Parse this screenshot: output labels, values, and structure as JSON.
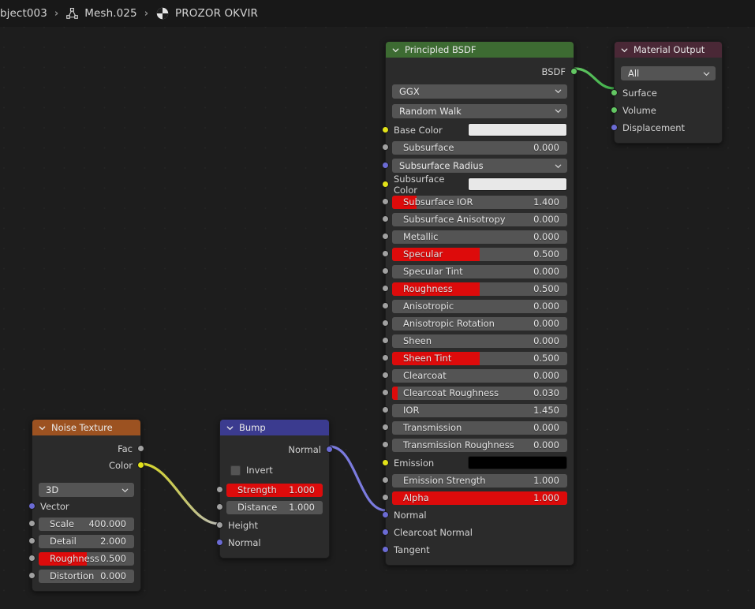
{
  "breadcrumb": {
    "object": "bject003",
    "mesh": "Mesh.025",
    "material": "PROZOR OKVIR",
    "separator": "›",
    "mesh_icon": "mesh-data-icon",
    "material_icon": "material-sphere-icon"
  },
  "colors": {
    "background": "#1d1d1d",
    "node_body": "#2b2b2b",
    "header_bsdf": "#3d6b32",
    "header_output": "#4a2836",
    "header_noise": "#9c5221",
    "header_bump": "#3b3b8f",
    "slider_track": "#545454",
    "slider_fill": "#dd0b0b",
    "socket_shader": "#63c763",
    "socket_color": "#e2e219",
    "socket_vector": "#6b6bd4",
    "socket_value": "#a1a1a1",
    "link_shader": "#4caf50",
    "link_color": "#d8d823",
    "link_vector": "#7b7bdd",
    "link_value": "#b0b0b0"
  },
  "nodes": {
    "principled_bsdf": {
      "title": "Principled BSDF",
      "outputs": [
        {
          "name": "BSDF",
          "socket": "shader"
        }
      ],
      "dropdowns": [
        {
          "name": "distribution",
          "value": "GGX"
        },
        {
          "name": "subsurface-method",
          "value": "Random Walk"
        }
      ],
      "color_inputs": [
        {
          "label": "Base Color",
          "color": "#e8e8e8",
          "socket": "color"
        },
        {
          "label": "Subsurface Color",
          "color": "#e8e8e8",
          "socket": "color"
        },
        {
          "label": "Emission",
          "color": "#000000",
          "socket": "color"
        }
      ],
      "subsurface_radius": {
        "label": "Subsurface Radius",
        "socket": "vector"
      },
      "values": [
        {
          "label": "Subsurface",
          "value": "0.000",
          "fill": 0
        },
        {
          "label": "Subsurface IOR",
          "value": "1.400",
          "fill": 14
        },
        {
          "label": "Subsurface Anisotropy",
          "value": "0.000",
          "fill": 0
        },
        {
          "label": "Metallic",
          "value": "0.000",
          "fill": 0
        },
        {
          "label": "Specular",
          "value": "0.500",
          "fill": 50
        },
        {
          "label": "Specular Tint",
          "value": "0.000",
          "fill": 0
        },
        {
          "label": "Roughness",
          "value": "0.500",
          "fill": 50
        },
        {
          "label": "Anisotropic",
          "value": "0.000",
          "fill": 0
        },
        {
          "label": "Anisotropic Rotation",
          "value": "0.000",
          "fill": 0
        },
        {
          "label": "Sheen",
          "value": "0.000",
          "fill": 0
        },
        {
          "label": "Sheen Tint",
          "value": "0.500",
          "fill": 50
        },
        {
          "label": "Clearcoat",
          "value": "0.000",
          "fill": 0
        },
        {
          "label": "Clearcoat Roughness",
          "value": "0.030",
          "fill": 3
        },
        {
          "label": "IOR",
          "value": "1.450",
          "fill": 0
        },
        {
          "label": "Transmission",
          "value": "0.000",
          "fill": 0
        },
        {
          "label": "Transmission Roughness",
          "value": "0.000",
          "fill": 0
        },
        {
          "label": "Emission Strength",
          "value": "1.000",
          "fill": 0
        },
        {
          "label": "Alpha",
          "value": "1.000",
          "fill": 100
        }
      ],
      "vector_inputs": [
        {
          "label": "Normal",
          "socket": "vector"
        },
        {
          "label": "Clearcoat Normal",
          "socket": "vector"
        },
        {
          "label": "Tangent",
          "socket": "vector"
        }
      ]
    },
    "material_output": {
      "title": "Material Output",
      "target": "All",
      "inputs": [
        {
          "label": "Surface",
          "socket": "shader"
        },
        {
          "label": "Volume",
          "socket": "shader"
        },
        {
          "label": "Displacement",
          "socket": "vector"
        }
      ]
    },
    "noise_texture": {
      "title": "Noise Texture",
      "outputs": [
        {
          "label": "Fac",
          "socket": "value"
        },
        {
          "label": "Color",
          "socket": "color"
        }
      ],
      "dimensions": "3D",
      "vector_input": {
        "label": "Vector",
        "socket": "vector"
      },
      "values": [
        {
          "label": "Scale",
          "value": "400.000",
          "fill": 0
        },
        {
          "label": "Detail",
          "value": "2.000",
          "fill": 0
        },
        {
          "label": "Roughness",
          "value": "0.500",
          "fill": 50
        },
        {
          "label": "Distortion",
          "value": "0.000",
          "fill": 0
        }
      ]
    },
    "bump": {
      "title": "Bump",
      "outputs": [
        {
          "label": "Normal",
          "socket": "vector"
        }
      ],
      "invert": {
        "label": "Invert",
        "checked": false
      },
      "values": [
        {
          "label": "Strength",
          "value": "1.000",
          "fill": 100
        },
        {
          "label": "Distance",
          "value": "1.000",
          "fill": 0
        }
      ],
      "inputs": [
        {
          "label": "Height",
          "socket": "value"
        },
        {
          "label": "Normal",
          "socket": "vector"
        }
      ]
    }
  }
}
